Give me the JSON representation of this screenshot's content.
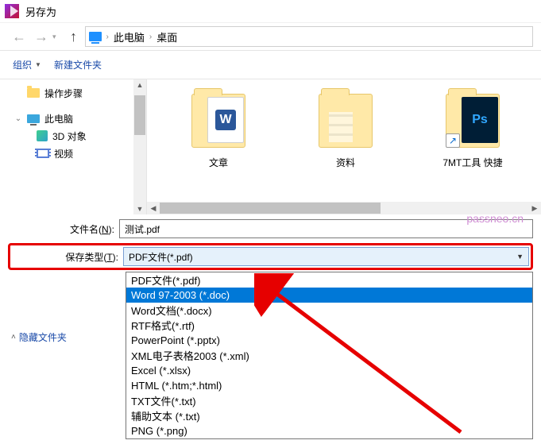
{
  "window": {
    "title": "另存为"
  },
  "breadcrumb": {
    "root": "此电脑",
    "folder": "桌面"
  },
  "toolbar": {
    "organize": "组织",
    "newfolder": "新建文件夹"
  },
  "tree": {
    "steps": "操作步骤",
    "pc": "此电脑",
    "threed": "3D 对象",
    "video": "视频"
  },
  "files": {
    "f1": "文章",
    "f2": "资料",
    "f3": "7MT工具 快捷"
  },
  "form": {
    "filename_label_pre": "文件名(",
    "filename_label_key": "N",
    "filename_label_post": "):",
    "filename_value": "测试.pdf",
    "savetype_label_pre": "保存类型(",
    "savetype_label_key": "T",
    "savetype_label_post": "):",
    "savetype_value": "PDF文件(*.pdf)"
  },
  "options": {
    "o0": "PDF文件(*.pdf)",
    "o1": "Word 97-2003 (*.doc)",
    "o2": "Word文档(*.docx)",
    "o3": "RTF格式(*.rtf)",
    "o4": "PowerPoint (*.pptx)",
    "o5": "XML电子表格2003 (*.xml)",
    "o6": "Excel (*.xlsx)",
    "o7": "HTML (*.htm;*.html)",
    "o8": "TXT文件(*.txt)",
    "o9": "辅助文本 (*.txt)",
    "o10": "PNG (*.png)"
  },
  "hide_folders": "隐藏文件夹",
  "watermark": "passneo.cn"
}
